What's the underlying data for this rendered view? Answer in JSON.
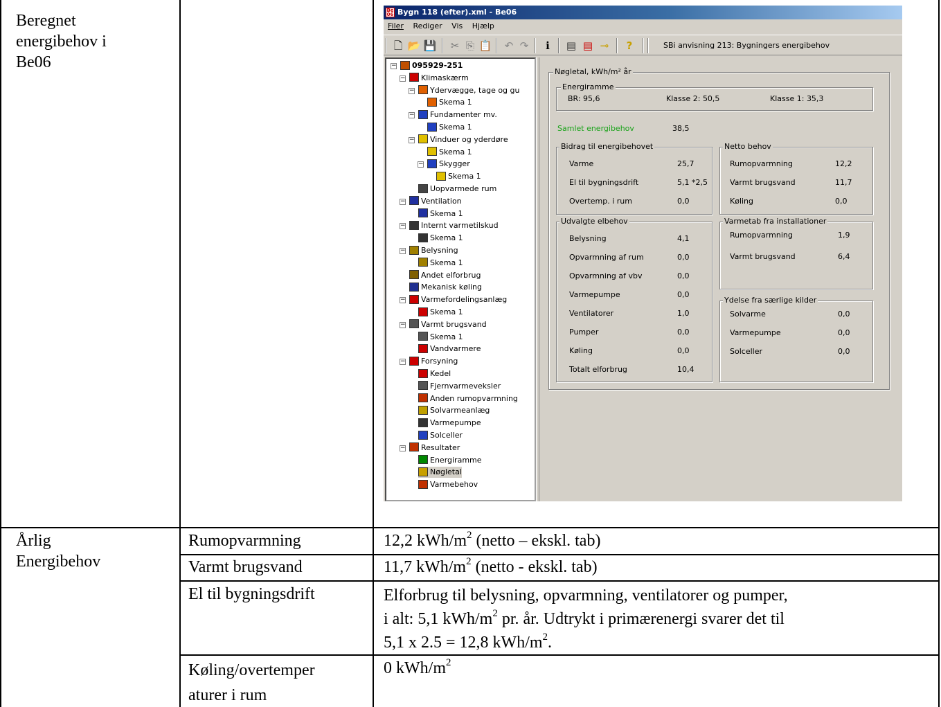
{
  "doc": {
    "row1_col1": [
      "Beregnet",
      "energibehov i",
      "Be06"
    ],
    "row2_col1": [
      "Årlig",
      "Energibehov"
    ],
    "items": [
      {
        "label": "Rumopvarmning",
        "value_pre": "12,2 kWh/m",
        "value_post": " (netto – ekskl. tab)"
      },
      {
        "label": "Varmt brugsvand",
        "value_pre": "11,7 kWh/m",
        "value_post": " (netto - ekskl. tab)"
      },
      {
        "label": "El til bygningsdrift",
        "line1": "Elforbrug til belysning, opvarmning, ventilatorer og pumper,",
        "line2_pre": "i alt: 5,1 kWh/m",
        "line2_post": " pr. år. Udtrykt i primærenergi svarer det til",
        "line3_pre": "5,1 x 2.5 = 12,8 kWh/m",
        "line3_post": "."
      },
      {
        "label_lines": [
          "Køling/overtemper",
          "aturer i rum"
        ],
        "value_pre": "0 kWh/m",
        "value_post": ""
      }
    ],
    "superscript": "2"
  },
  "window": {
    "title": "Bygn 118 (efter).xml - Be06",
    "menu": [
      "Filer",
      "Rediger",
      "Vis",
      "Hjælp"
    ],
    "toolbar_title": "SBi anvisning 213: Bygningers energibehov",
    "tree": [
      "095929-251",
      "Klimaskærm",
      "Ydervægge, tage og gu",
      "Skema 1",
      "Fundamenter mv.",
      "Skema 1",
      "Vinduer og yderdøre",
      "Skema 1",
      "Skygger",
      "Skema 1",
      "Uopvarmede rum",
      "Ventilation",
      "Skema 1",
      "Internt varmetilskud",
      "Skema 1",
      "Belysning",
      "Skema 1",
      "Andet elforbrug",
      "Mekanisk køling",
      "Varmefordelingsanlæg",
      "Skema 1",
      "Varmt brugsvand",
      "Skema 1",
      "Vandvarmere",
      "Forsyning",
      "Kedel",
      "Fjernvarmeveksler",
      "Anden rumopvarmning",
      "Solvarmeanlæg",
      "Varmepumpe",
      "Solceller",
      "Resultater",
      "Energiramme",
      "Nøgletal",
      "Varmebehov"
    ],
    "panel": {
      "title": "Nøgletal, kWh/m² år",
      "energiramme": {
        "title": "Energiramme",
        "br": "BR: 95,6",
        "klasse2": "Klasse 2:  50,5",
        "klasse1": "Klasse 1:  35,3"
      },
      "samlet_label": "Samlet energibehov",
      "samlet_value": "38,5",
      "bidrag": {
        "title": "Bidrag til energibehovet",
        "rows": [
          {
            "label": "Varme",
            "value": "25,7"
          },
          {
            "label": "El til bygningsdrift",
            "value": "5,1 *2,5"
          },
          {
            "label": "Overtemp. i rum",
            "value": "0,0"
          }
        ]
      },
      "netto": {
        "title": "Netto behov",
        "rows": [
          {
            "label": "Rumopvarmning",
            "value": "12,2"
          },
          {
            "label": "Varmt brugsvand",
            "value": "11,7"
          },
          {
            "label": "Køling",
            "value": "0,0"
          }
        ]
      },
      "elbehov": {
        "title": "Udvalgte elbehov",
        "rows": [
          {
            "label": "Belysning",
            "value": "4,1"
          },
          {
            "label": "Opvarmning af rum",
            "value": "0,0"
          },
          {
            "label": "Opvarmning af vbv",
            "value": "0,0"
          },
          {
            "label": "Varmepumpe",
            "value": "0,0"
          },
          {
            "label": "Ventilatorer",
            "value": "1,0"
          },
          {
            "label": "Pumper",
            "value": "0,0"
          },
          {
            "label": "Køling",
            "value": "0,0"
          },
          {
            "label": "Totalt elforbrug",
            "value": "10,4"
          }
        ]
      },
      "varmetab": {
        "title": "Varmetab fra installationer",
        "rows": [
          {
            "label": "Rumopvarmning",
            "value": "1,9"
          },
          {
            "label": "Varmt brugsvand",
            "value": "6,4"
          }
        ]
      },
      "ydelse": {
        "title": "Ydelse fra særlige kilder",
        "rows": [
          {
            "label": "Solvarme",
            "value": "0,0"
          },
          {
            "label": "Varmepumpe",
            "value": "0,0"
          },
          {
            "label": "Solceller",
            "value": "0,0"
          }
        ]
      }
    }
  }
}
